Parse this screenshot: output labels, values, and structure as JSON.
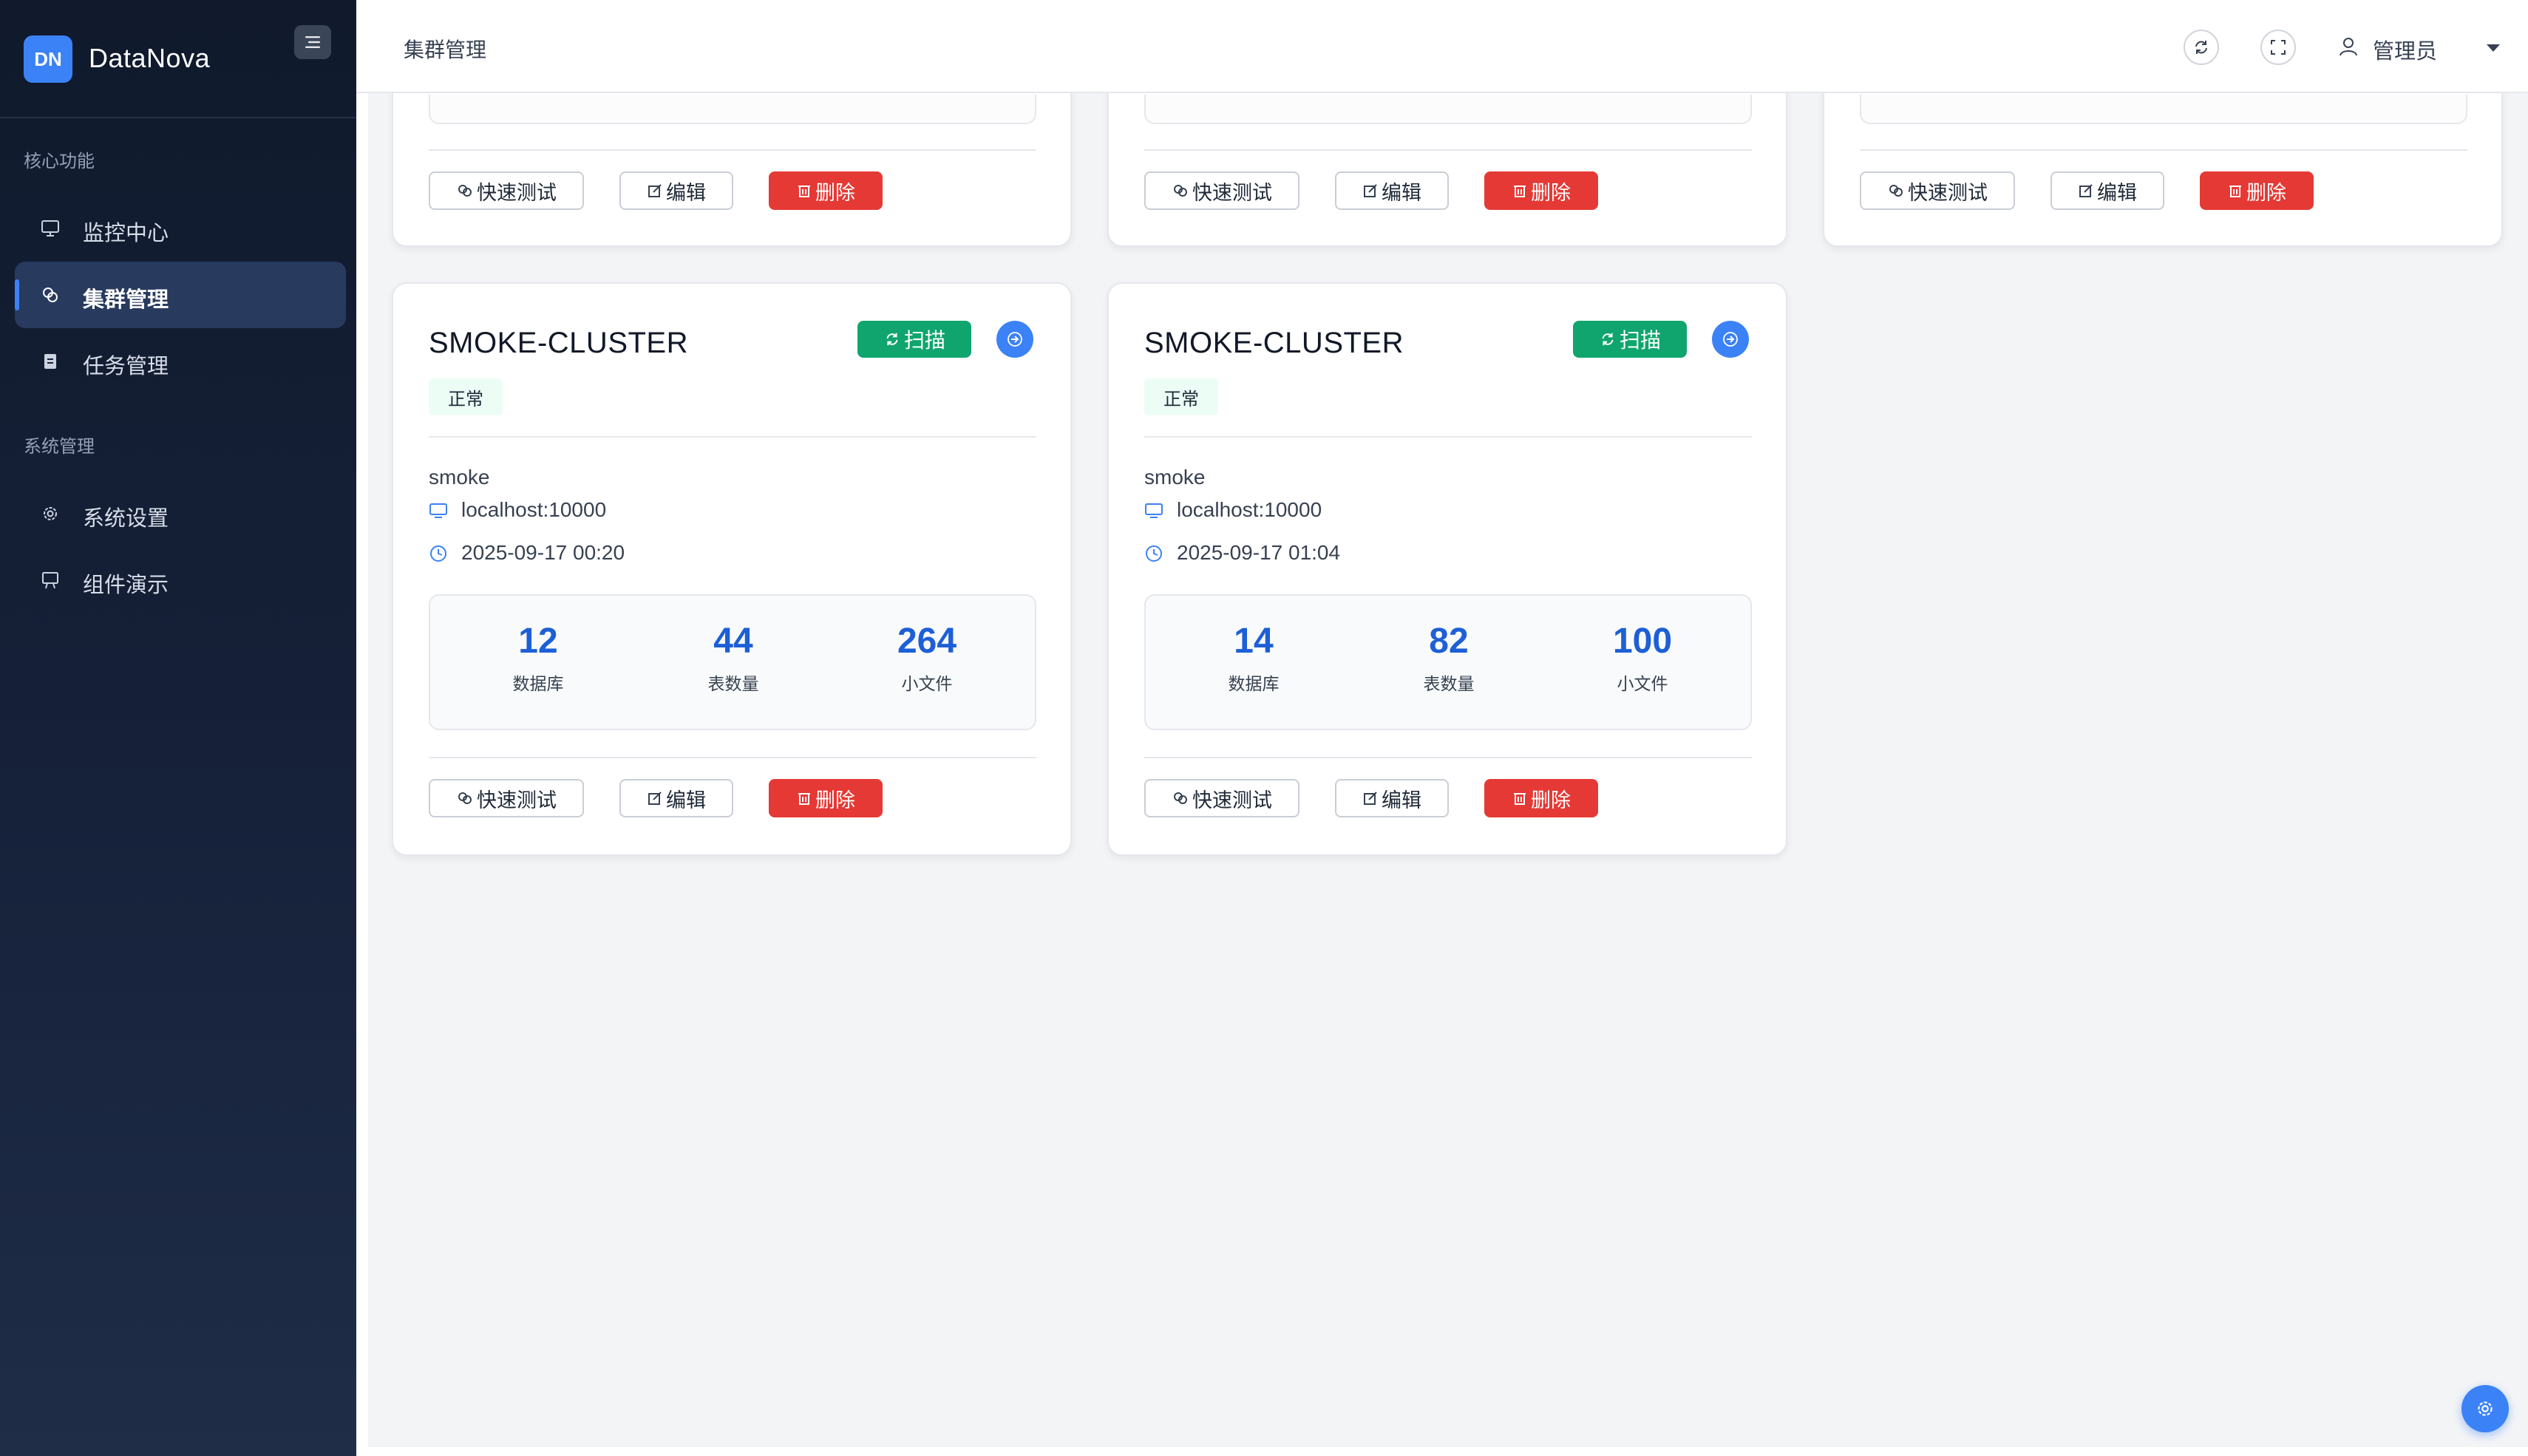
{
  "app": {
    "logo_text": "DN",
    "name": "DataNova"
  },
  "sidebar": {
    "sections": [
      {
        "title": "核心功能",
        "items": [
          {
            "label": "监控中心",
            "icon": "monitor-icon",
            "active": false
          },
          {
            "label": "集群管理",
            "icon": "cluster-link-icon",
            "active": true
          },
          {
            "label": "任务管理",
            "icon": "clipboard-icon",
            "active": false
          }
        ]
      },
      {
        "title": "系统管理",
        "items": [
          {
            "label": "系统设置",
            "icon": "gear-icon",
            "active": false
          },
          {
            "label": "组件演示",
            "icon": "presentation-icon",
            "active": false
          }
        ]
      }
    ]
  },
  "topbar": {
    "page_title": "集群管理",
    "user_name": "管理员"
  },
  "card_actions": {
    "quick_test": "快速测试",
    "edit": "编辑",
    "delete": "删除",
    "scan": "扫描"
  },
  "stat_labels": {
    "databases": "数据库",
    "tables": "表数量",
    "small_files": "小文件"
  },
  "clusters": [
    {
      "name": "SMOKE-CLUSTER",
      "status": "正常",
      "description": "smoke",
      "host": "localhost:10000",
      "time": "2025-09-17 00:20",
      "databases": "12",
      "tables": "44",
      "small_files": "264"
    },
    {
      "name": "SMOKE-CLUSTER",
      "status": "正常",
      "description": "smoke",
      "host": "localhost:10000",
      "time": "2025-09-17 01:04",
      "databases": "14",
      "tables": "82",
      "small_files": "100"
    }
  ],
  "colors": {
    "sidebar_bg": "#16213a",
    "accent": "#3b82f6",
    "scan_green": "#10a56e",
    "danger": "#e53935",
    "stat_blue": "#1d5fd6"
  }
}
